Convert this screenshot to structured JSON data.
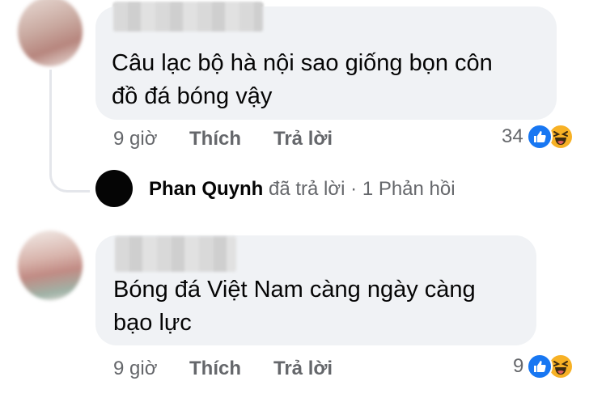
{
  "comments": [
    {
      "text_line1": "Câu lạc bộ hà nội sao giống bọn côn",
      "text_line2": "đồ đá bóng vậy",
      "time": "9 giờ",
      "like_label": "Thích",
      "reply_label": "Trả lời",
      "reaction_count": "34",
      "reactions": [
        "like-icon",
        "haha-icon"
      ]
    },
    {
      "text_line1": "Bóng đá Việt Nam càng ngày càng",
      "text_line2": "bạo lực",
      "time": "9 giờ",
      "like_label": "Thích",
      "reply_label": "Trả lời",
      "reaction_count": "9",
      "reactions": [
        "like-icon",
        "haha-icon"
      ]
    }
  ],
  "reply_summary": {
    "name": "Phan Quynh",
    "action": "đã trả lời",
    "separator": "·",
    "count": "1 Phản hồi"
  },
  "colors": {
    "bubble": "#f0f2f5",
    "meta_text": "#65676b",
    "like_blue": "#1877f2",
    "haha_yellow": "#f7b125"
  }
}
